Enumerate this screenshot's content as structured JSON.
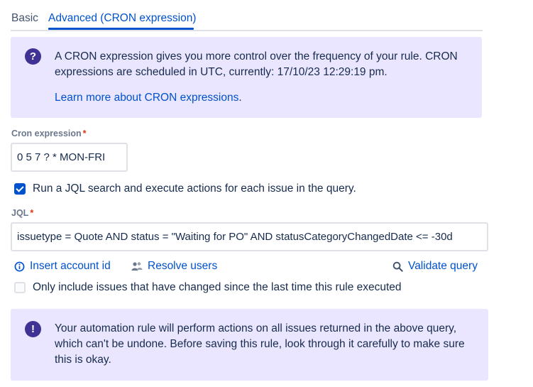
{
  "tabs": {
    "basic": "Basic",
    "advanced": "Advanced (CRON expression)"
  },
  "info_panel": {
    "icon": "question-circle-icon",
    "text": "A CRON expression gives you more control over the frequency of your rule. CRON expressions are scheduled in UTC, currently: 17/10/23 12:29:19 pm.",
    "link_text": "Learn more about CRON expressions",
    "link_suffix": "."
  },
  "cron": {
    "label": "Cron expression",
    "required_marker": "*",
    "value": "0 5 7 ? * MON-FRI"
  },
  "jql_checkbox": {
    "checked": true,
    "label": "Run a JQL search and execute actions for each issue in the query."
  },
  "jql": {
    "label": "JQL",
    "required_marker": "*",
    "value": "issuetype = Quote AND status = \"Waiting for PO\" AND statusCategoryChangedDate <= -30d"
  },
  "actions": {
    "insert_account_id": "Insert account id",
    "resolve_users": "Resolve users",
    "validate_query": "Validate query"
  },
  "changed_checkbox": {
    "checked": false,
    "label": "Only include issues that have changed since the last time this rule executed"
  },
  "warning_panel": {
    "icon": "exclamation-circle-icon",
    "text": "Your automation rule will perform actions on all issues returned in the above query, which can't be undone. Before saving this rule, look through it carefully to make sure this is okay."
  },
  "colors": {
    "accent": "#0052cc",
    "panel_bg": "#eae6ff",
    "panel_icon": "#403294",
    "required": "#de350b"
  }
}
